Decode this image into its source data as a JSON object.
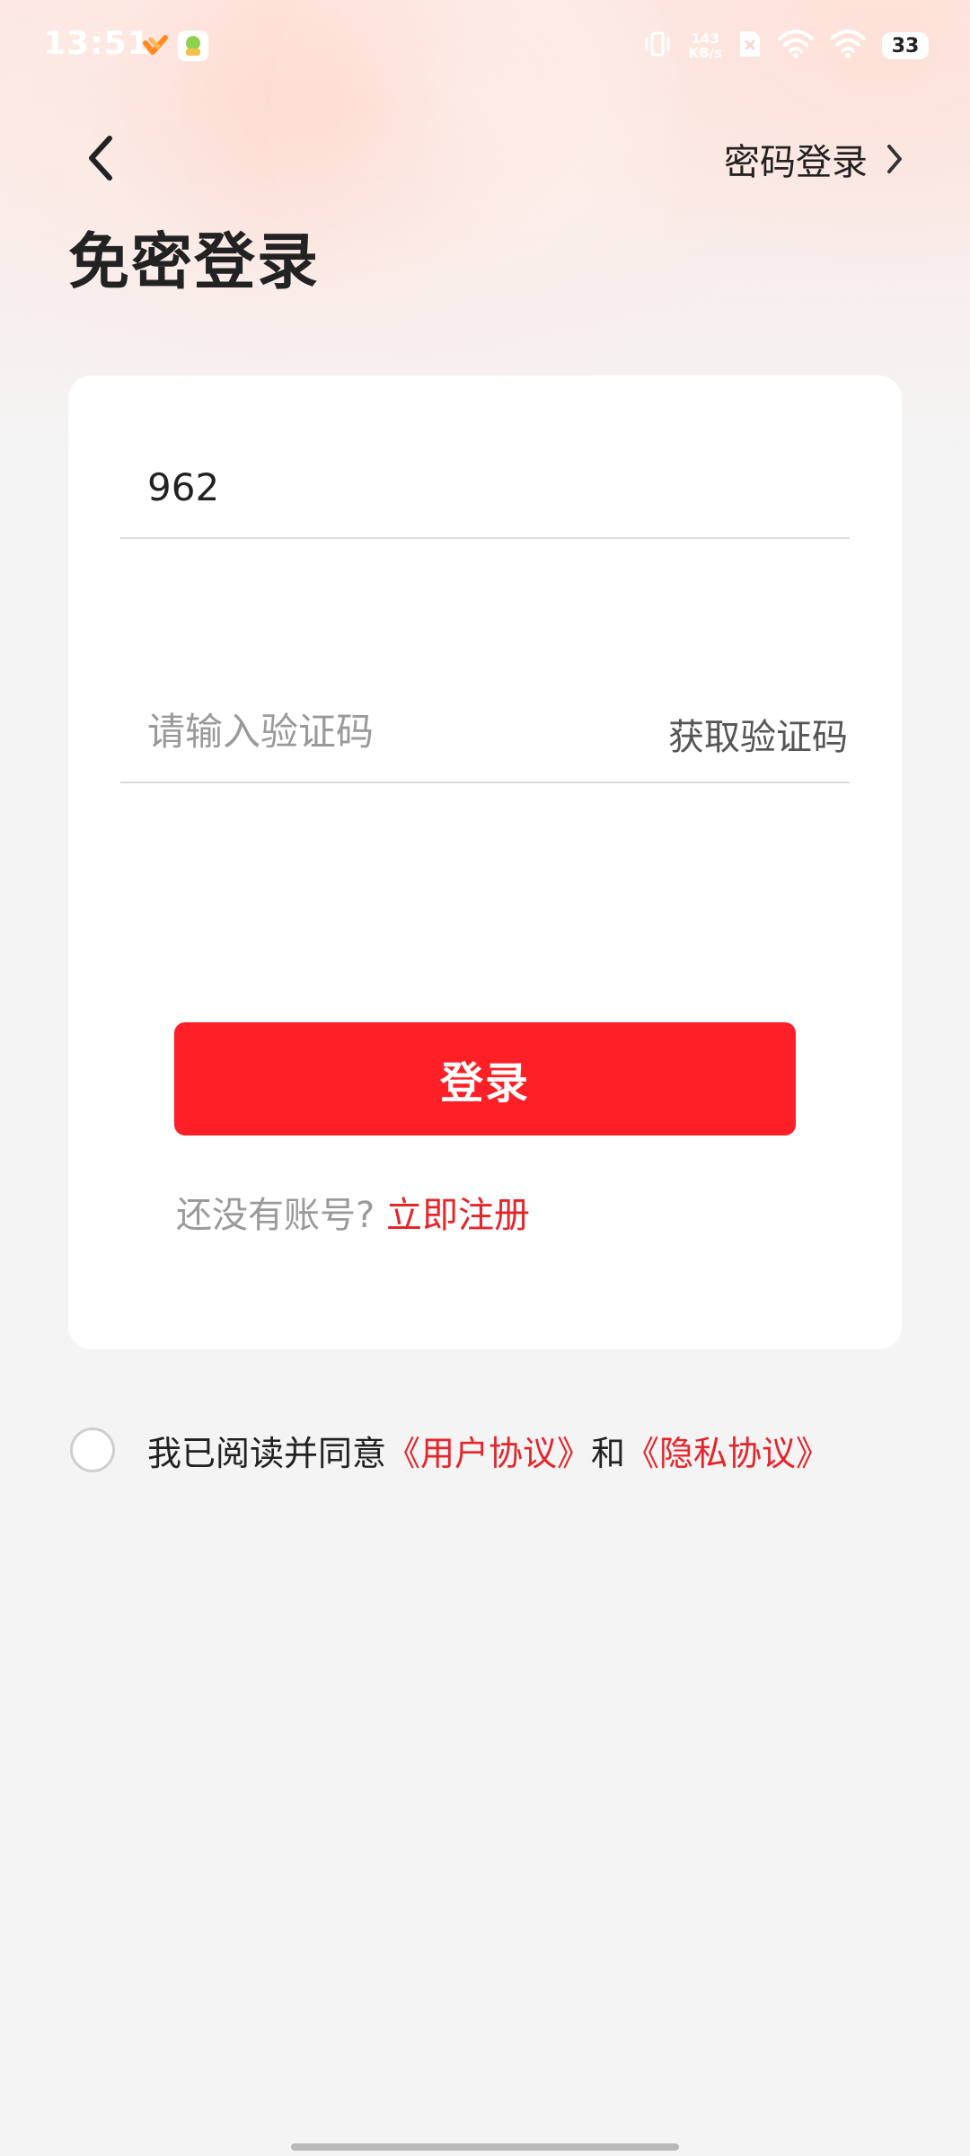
{
  "status_bar": {
    "time": "13:51",
    "net_speed_value": "143",
    "net_speed_unit": "KB/s",
    "battery": "33"
  },
  "nav": {
    "password_login_label": "密码登录"
  },
  "page": {
    "title": "免密登录"
  },
  "form": {
    "phone_value": "962",
    "code_placeholder": "请输入验证码",
    "get_code_label": "获取验证码",
    "login_label": "登录",
    "register_prompt": "还没有账号?",
    "register_link": "立即注册"
  },
  "agreement": {
    "checked": false,
    "prefix": "我已阅读并同意",
    "user_agreement": "《用户协议》",
    "and": "和",
    "privacy_agreement": "《隐私协议》"
  },
  "colors": {
    "accent": "#ff1f26",
    "link": "#e4262b",
    "background": "#f4f4f5",
    "card": "#ffffff"
  },
  "icons": [
    "back-arrow-icon",
    "chevron-right-icon",
    "vibrate-icon",
    "wifi-icon",
    "battery-icon",
    "circle-checkbox-icon"
  ]
}
